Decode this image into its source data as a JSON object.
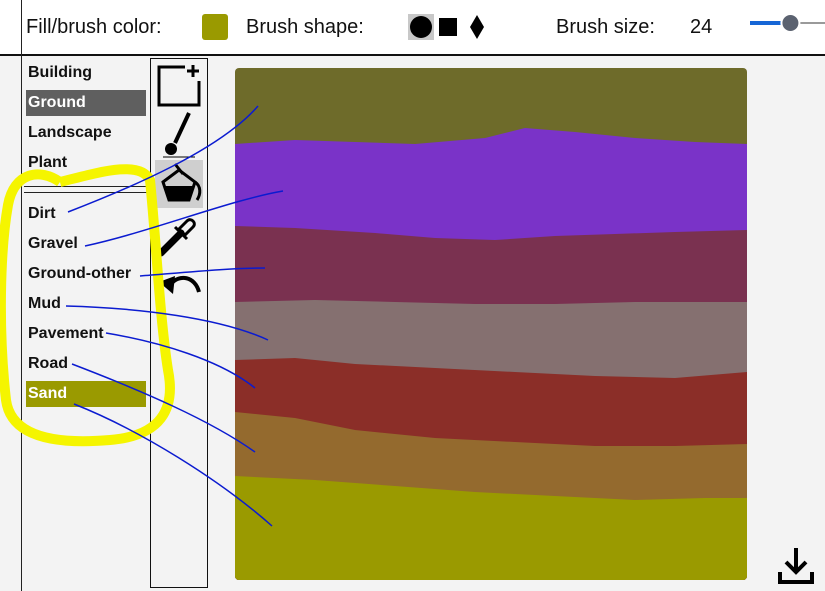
{
  "toolbar": {
    "fill_label": "Fill/brush color:",
    "fill_color": "#9a9a00",
    "shape_label": "Brush shape:",
    "shapes": [
      "circle-icon",
      "square-icon",
      "diamond-icon"
    ],
    "size_label": "Brush size:",
    "size_value": "24",
    "slider_fraction": 0.47
  },
  "categories": [
    {
      "label": "Building",
      "selected": false
    },
    {
      "label": "Ground",
      "selected": true
    },
    {
      "label": "Landscape",
      "selected": false
    },
    {
      "label": "Plant",
      "selected": false
    }
  ],
  "subcategories": [
    {
      "label": "Dirt",
      "selected": false
    },
    {
      "label": "Gravel",
      "selected": false
    },
    {
      "label": "Ground-other",
      "selected": false
    },
    {
      "label": "Mud",
      "selected": false
    },
    {
      "label": "Pavement",
      "selected": false
    },
    {
      "label": "Road",
      "selected": false
    },
    {
      "label": "Sand",
      "selected": true
    }
  ],
  "tools": [
    "new-canvas-icon",
    "brush-icon",
    "fill-bucket-icon",
    "eyedropper-icon",
    "undo-icon"
  ],
  "active_tool": "fill-bucket-icon",
  "colors": {
    "selected_category_bg": "#5f5f5f",
    "selected_sub_bg": "#9a9a00",
    "annotation_line": "#0b1bd0",
    "highlight": "#f5f500",
    "band_1": "#6e6b2a",
    "band_2": "#7a33c8",
    "band_3": "#7a3150",
    "band_4": "#857070",
    "band_5": "#8b2e28",
    "band_6": "#946a2e",
    "band_7": "#9a9a00"
  },
  "download_icon": "download-icon"
}
